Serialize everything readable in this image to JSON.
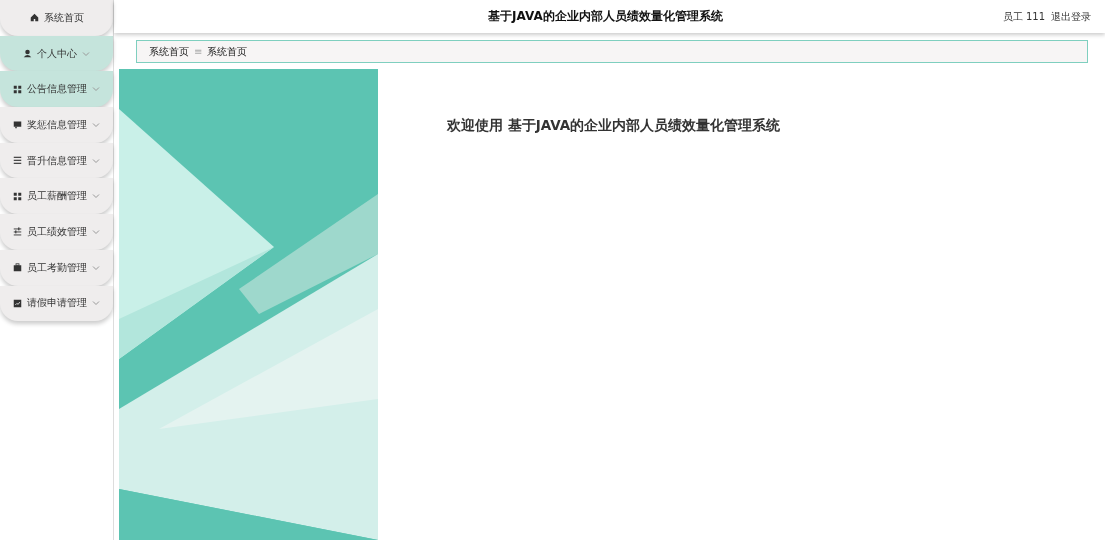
{
  "sidebar": {
    "items": [
      {
        "label": "系统首页",
        "expandable": false,
        "selected": false
      },
      {
        "label": "个人中心",
        "expandable": true,
        "selected": true
      },
      {
        "label": "公告信息管理",
        "expandable": true,
        "selected": true
      },
      {
        "label": "奖惩信息管理",
        "expandable": true,
        "selected": false
      },
      {
        "label": "晋升信息管理",
        "expandable": true,
        "selected": false
      },
      {
        "label": "员工薪酬管理",
        "expandable": true,
        "selected": false
      },
      {
        "label": "员工绩效管理",
        "expandable": true,
        "selected": false
      },
      {
        "label": "员工考勤管理",
        "expandable": true,
        "selected": false
      },
      {
        "label": "请假申请管理",
        "expandable": true,
        "selected": false
      }
    ]
  },
  "header": {
    "title": "基于JAVA的企业内部人员绩效量化管理系统",
    "user": "员工 111",
    "logout": "退出登录"
  },
  "breadcrumb": {
    "items": [
      "系统首页",
      "系统首页"
    ],
    "separator": "≡"
  },
  "welcome": "欢迎使用 基于JAVA的企业内部人员绩效量化管理系统"
}
